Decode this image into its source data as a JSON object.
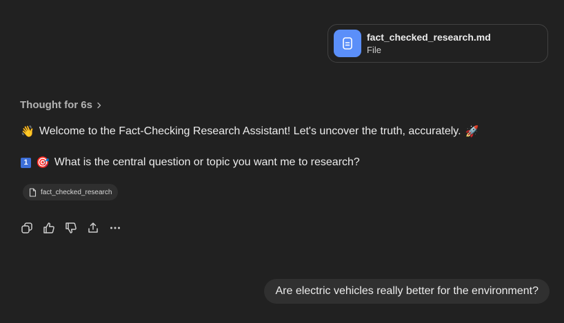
{
  "attachment": {
    "file_name": "fact_checked_research.md",
    "file_type": "File",
    "icon": "document-icon",
    "icon_color": "#5b8ff9"
  },
  "thought": {
    "label": "Thought for 6s",
    "icon": "chevron-right-icon"
  },
  "assistant": {
    "line1": {
      "emoji_before": "👋",
      "text": "Welcome to the Fact-Checking Research Assistant! Let's uncover the truth, accurately.",
      "emoji_after": "🚀"
    },
    "line2": {
      "number_badge": "1",
      "emoji": "🎯",
      "text": "What is the central question or topic you want me to research?"
    },
    "source_chip": {
      "label": "fact_checked_research",
      "icon": "document-icon"
    }
  },
  "action_bar": {
    "icons": [
      "copy-icon",
      "thumbs-up-icon",
      "thumbs-down-icon",
      "share-icon",
      "more-icon"
    ]
  },
  "user_message": {
    "text": "Are electric vehicles really better for the environment?"
  },
  "colors": {
    "background": "#212121",
    "bubble": "#303030",
    "chip": "#2f2f2f",
    "accent": "#5b8ff9"
  }
}
